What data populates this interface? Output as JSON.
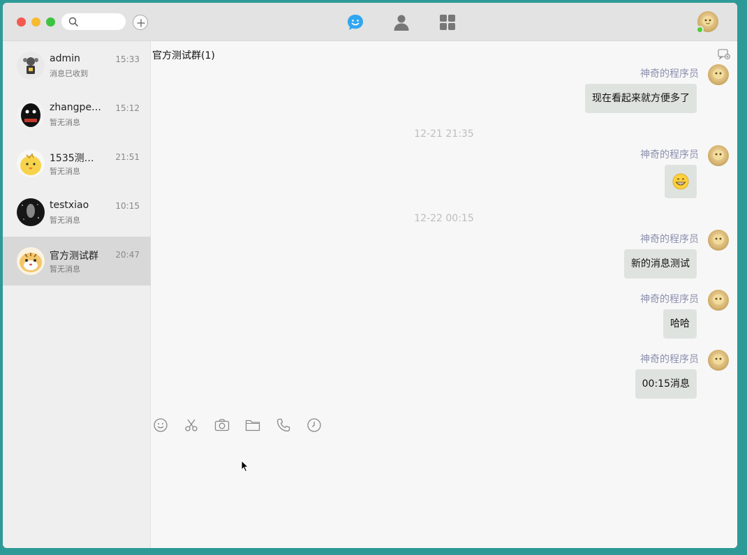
{
  "window": {
    "search": {
      "placeholder": ""
    },
    "nav": [
      "chat-icon",
      "contacts-icon",
      "apps-grid-icon"
    ],
    "accent_color": "#31a6f0"
  },
  "sidebar": {
    "conversations": [
      {
        "name": "admin",
        "time": "15:33",
        "preview": "消息已收到",
        "active": false
      },
      {
        "name": "zhangpe…",
        "time": "15:12",
        "preview": "暂无消息",
        "active": false
      },
      {
        "name": "1535测…",
        "time": "21:51",
        "preview": "暂无消息",
        "active": false
      },
      {
        "name": "testxiao",
        "time": "10:15",
        "preview": "暂无消息",
        "active": false
      },
      {
        "name": "官方测试群",
        "time": "20:47",
        "preview": "暂无消息",
        "active": true
      }
    ]
  },
  "chat": {
    "title": "官方测试群(1)",
    "messages": [
      {
        "sender": "神奇的程序员",
        "text": "现在看起来就方便多了"
      },
      {
        "timestamp": "12-21 21:35"
      },
      {
        "sender": "神奇的程序员",
        "emoji": "grinning-emoji"
      },
      {
        "timestamp": "12-22 00:15"
      },
      {
        "sender": "神奇的程序员",
        "text": "新的消息测试"
      },
      {
        "sender": "神奇的程序员",
        "text": "哈哈"
      },
      {
        "sender": "神奇的程序员",
        "text": "00:15消息"
      }
    ],
    "toolbar": [
      "emoji-icon",
      "screenshot-scissors-icon",
      "camera-icon",
      "folder-icon",
      "phone-icon",
      "history-clock-icon"
    ]
  }
}
